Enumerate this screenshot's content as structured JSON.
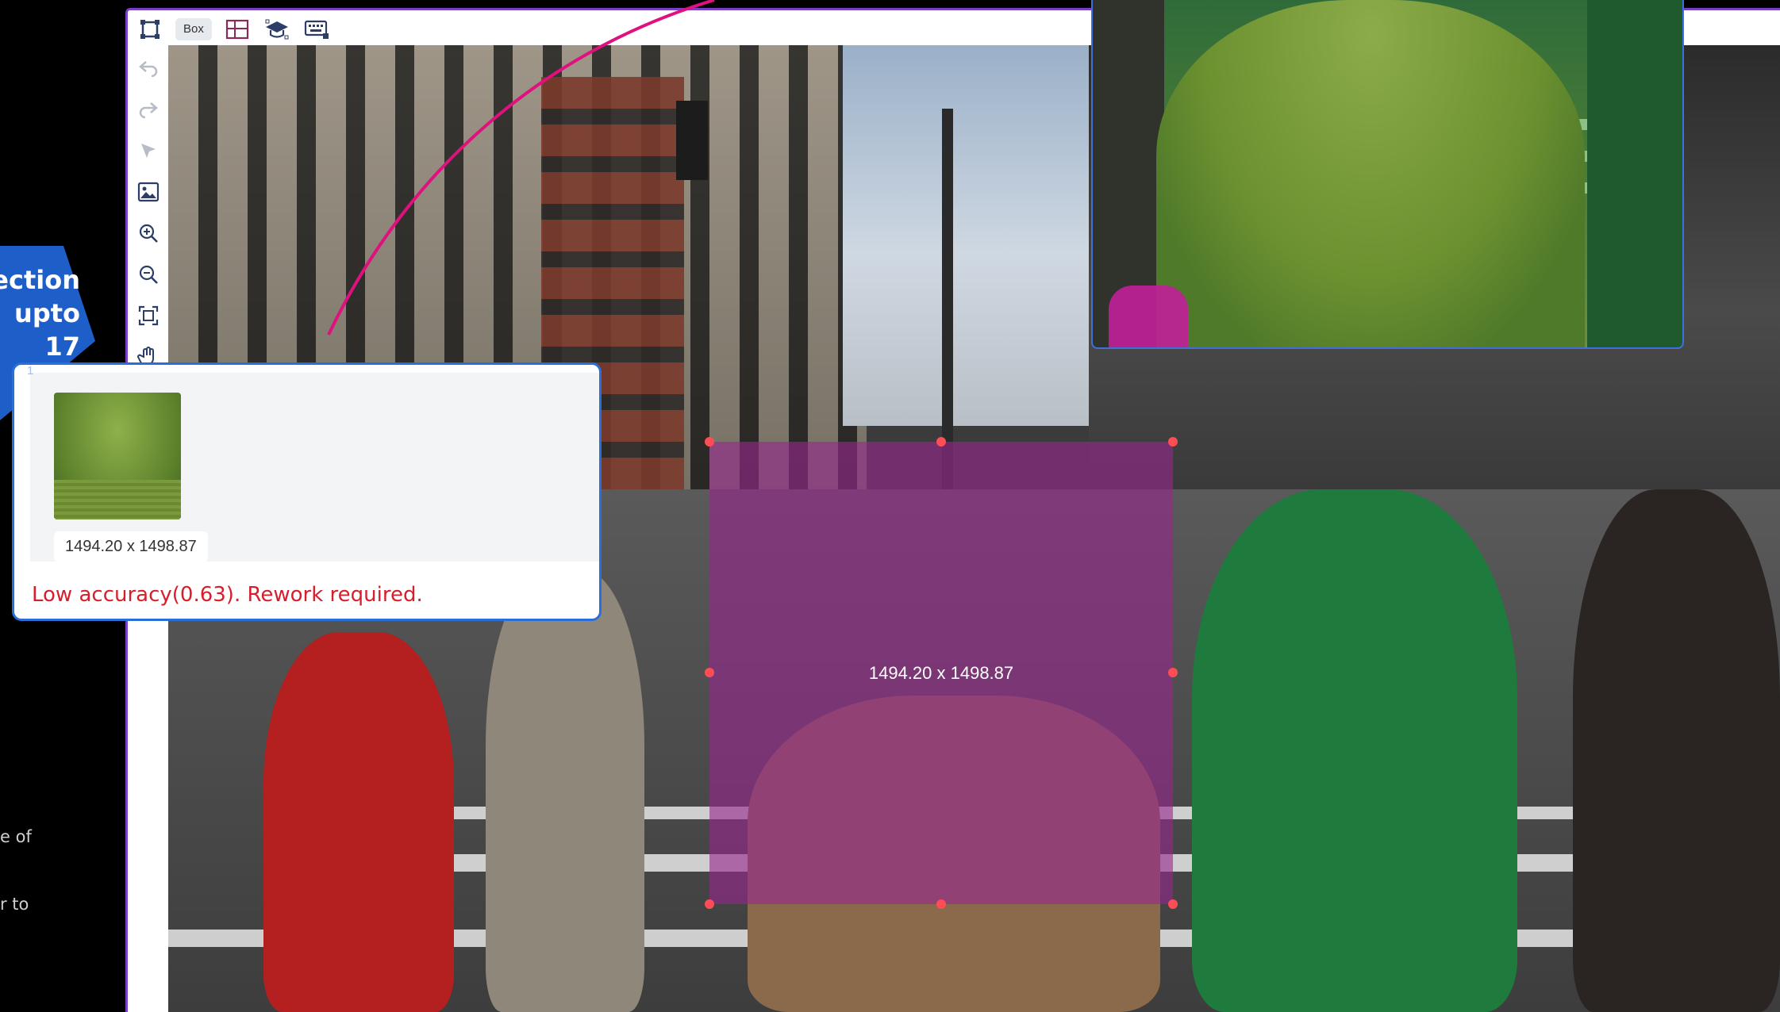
{
  "side_panel": {
    "title_line1": "pection",
    "title_line2": "upto 17",
    "desc_line1": "e of",
    "desc_line2": "r to"
  },
  "toolbar": {
    "box_label": "Box",
    "icons": [
      "bounding-box-icon",
      "grid-icon",
      "graduation-cap-icon",
      "keyboard-icon"
    ]
  },
  "tools": [
    "undo-icon",
    "redo-icon",
    "pointer-icon",
    "image-icon",
    "zoom-in-icon",
    "zoom-out-icon",
    "fit-screen-icon",
    "hand-icon"
  ],
  "annotation": {
    "dimensions": "1494.20 x 1498.87",
    "color": "#96288c"
  },
  "card": {
    "index": "1",
    "dimensions": "1494.20 x 1498.87",
    "warning": "Low accuracy(0.63). Rework required.",
    "warning_color": "#d61f2b",
    "border_color": "#2a6fd8"
  },
  "colors": {
    "accent": "#e0107f",
    "frame": "#7a3ec8"
  }
}
